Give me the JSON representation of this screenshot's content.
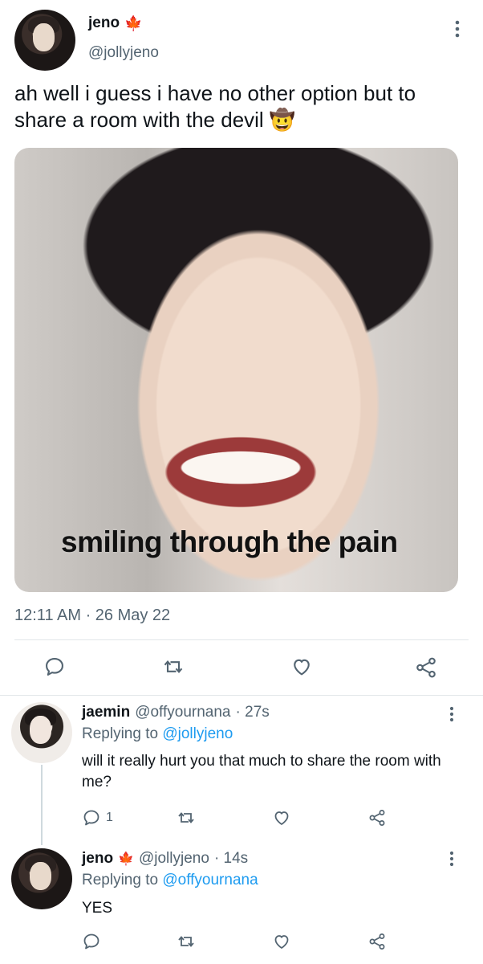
{
  "main_tweet": {
    "display_name": "jeno",
    "name_emoji": "🍁",
    "handle": "@jollyjeno",
    "text": "ah well i guess i have no other option but to share a room with the devil 🤠",
    "media_caption": "smiling through the pain",
    "timestamp": "12:11 AM · 26 May 22",
    "menu_icon": "more-vertical-icon"
  },
  "replies": [
    {
      "display_name": "jaemin",
      "handle": "@offyournana",
      "time": "· 27s",
      "replying_prefix": "Replying to",
      "replying_to": "@jollyjeno",
      "text": "will it really hurt you that much to share the room with me?",
      "reply_count": "1"
    },
    {
      "display_name": "jeno",
      "name_emoji": "🍁",
      "handle": "@jollyjeno",
      "time": "· 14s",
      "replying_prefix": "Replying to",
      "replying_to": "@offyournana",
      "text": "YES",
      "reply_count": ""
    }
  ],
  "actions": [
    "reply-icon",
    "retweet-icon",
    "like-icon",
    "share-icon"
  ],
  "colors": {
    "link": "#1d9bf0",
    "muted": "#536471",
    "text": "#0f1419",
    "divider": "#e2e6e9"
  }
}
